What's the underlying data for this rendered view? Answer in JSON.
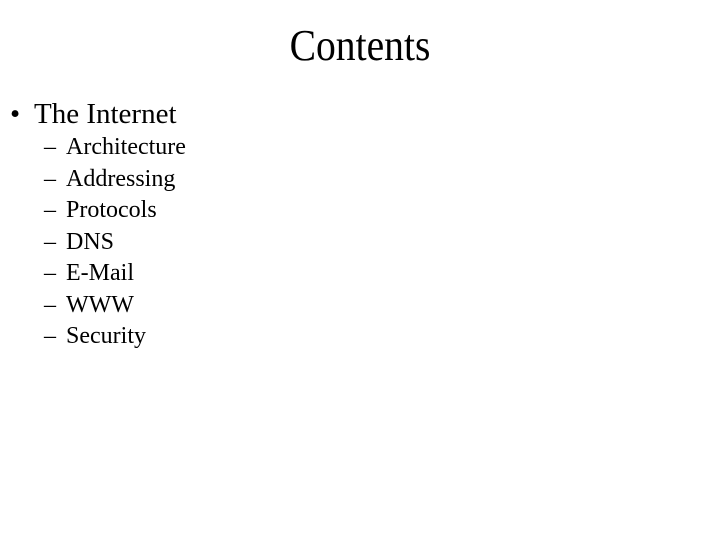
{
  "slide": {
    "title": "Contents",
    "bullets": [
      {
        "marker": "•",
        "text": "The Internet",
        "subitems": [
          {
            "marker": "–",
            "text": "Architecture"
          },
          {
            "marker": "–",
            "text": "Addressing"
          },
          {
            "marker": "–",
            "text": "Protocols"
          },
          {
            "marker": "–",
            "text": "DNS"
          },
          {
            "marker": "–",
            "text": "E-Mail"
          },
          {
            "marker": "–",
            "text": "WWW"
          },
          {
            "marker": "–",
            "text": "Security"
          }
        ]
      }
    ]
  }
}
